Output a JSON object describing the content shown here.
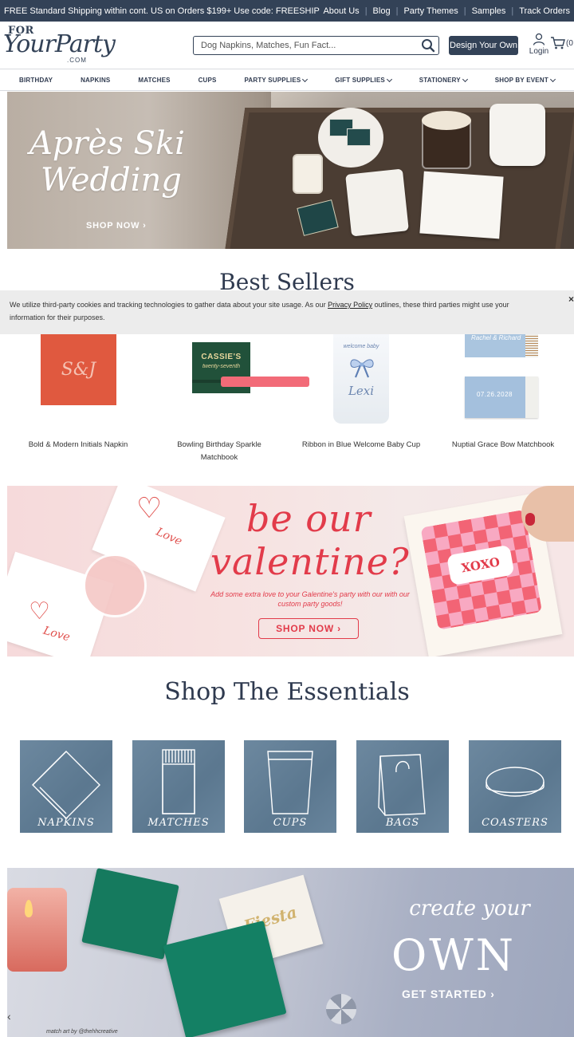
{
  "topbar": {
    "promo": "FREE Standard Shipping within cont. US on Orders $199+ Use code: FREESHIP",
    "links": [
      "About Us",
      "Blog",
      "Party Themes",
      "Samples",
      "Track Orders"
    ]
  },
  "header": {
    "logo_for": "FOR",
    "logo_name": "YourParty",
    "logo_com": ".COM",
    "search_placeholder": "Dog Napkins, Matches, Fun Fact...",
    "design_button": "Design Your Own",
    "login": "Login",
    "cart_count": "(0"
  },
  "nav": [
    {
      "label": "BIRTHDAY",
      "dropdown": false
    },
    {
      "label": "NAPKINS",
      "dropdown": false
    },
    {
      "label": "MATCHES",
      "dropdown": false
    },
    {
      "label": "CUPS",
      "dropdown": false
    },
    {
      "label": "PARTY SUPPLIES",
      "dropdown": true
    },
    {
      "label": "GIFT SUPPLIES",
      "dropdown": true
    },
    {
      "label": "STATIONERY",
      "dropdown": true
    },
    {
      "label": "SHOP BY EVENT",
      "dropdown": true
    }
  ],
  "hero": {
    "title_line1": "Après Ski",
    "title_line2": "Wedding",
    "cta": "SHOP NOW ›"
  },
  "best_sellers": {
    "title": "Best Sellers",
    "products": [
      {
        "name": "Bold & Modern Initials Napkin",
        "image_text": "S&J"
      },
      {
        "name": "Bowling Birthday Sparkle Matchbook",
        "image_text_1": "CASSIE'S",
        "image_text_2": "twenty-seventh"
      },
      {
        "name": "Ribbon in Blue Welcome Baby Cup",
        "image_text_1": "welcome baby",
        "image_text_2": "Lexi"
      },
      {
        "name": "Nuptial Grace Bow Matchbook",
        "image_text_1": "Rachel & Richard",
        "image_text_2": "07.26.2028"
      }
    ]
  },
  "cookie": {
    "text_before": "We utilize third-party cookies and tracking technologies to gather data about your site usage. As our ",
    "link": "Privacy Policy",
    "text_after": " outlines, these third parties might use your information for their purposes.",
    "close": "×"
  },
  "valentine": {
    "headline_1": "be our",
    "headline_2": "valentine?",
    "sub": "Add some extra love to your Galentine's party with our with our custom party goods!",
    "cta": "SHOP NOW ›",
    "napkin_text": "Love",
    "card_text": "XOXO"
  },
  "essentials": {
    "title": "Shop The Essentials",
    "tiles": [
      "NAPKINS",
      "MATCHES",
      "CUPS",
      "BAGS",
      "COASTERS"
    ]
  },
  "create": {
    "line1": "create your",
    "line2": "OWN",
    "cta": "GET STARTED ›",
    "credit": "match art by @thehhcreative",
    "box_text": "Fiesta"
  },
  "colors": {
    "navy": "#334257",
    "valentine_red": "#e23b4a",
    "tile_blue": "#607e97"
  }
}
